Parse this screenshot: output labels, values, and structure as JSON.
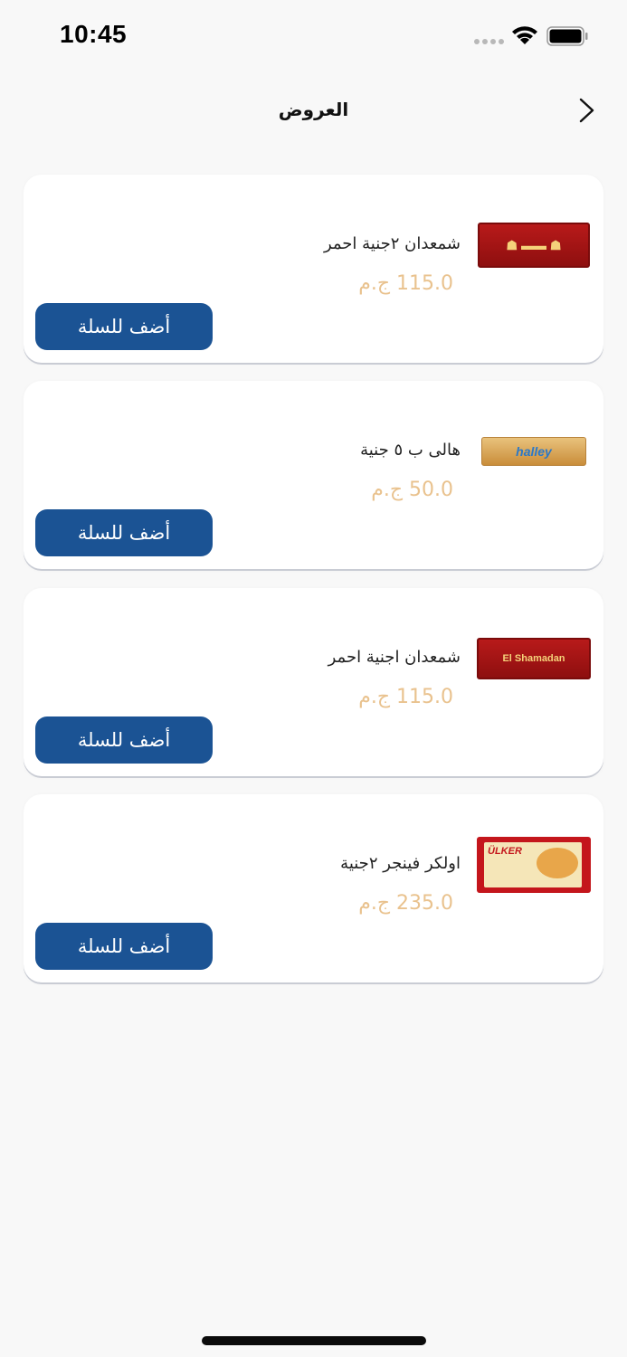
{
  "status_bar": {
    "time": "10:45"
  },
  "header": {
    "title": "العروض"
  },
  "currency": "ج.م",
  "products": [
    {
      "name": "شمعدان ٢جنية احمر",
      "price": "115.0 ج.م",
      "image_icon": "shamadan-red-pack-icon",
      "add_label": "أضف للسلة"
    },
    {
      "name": "هالى ب ٥ جنية",
      "price": "50.0 ج.م",
      "image_icon": "halley-pack-icon",
      "add_label": "أضف للسلة"
    },
    {
      "name": "شمعدان اجنية احمر",
      "price": "115.0 ج.م",
      "image_icon": "el-shamadan-pack-icon",
      "add_label": "أضف للسلة"
    },
    {
      "name": "اولكر فينجر ٢جنية",
      "price": "235.0 ج.م",
      "image_icon": "ulker-finger-biscuits-icon",
      "add_label": "أضف للسلة"
    }
  ],
  "image_texts": {
    "halley": "halley",
    "shamadan": "El Shamadan",
    "ulker": "ÜLKER"
  },
  "colors": {
    "button": "#1b5394",
    "price": "#e9c28e",
    "background": "#f8f8f8"
  }
}
